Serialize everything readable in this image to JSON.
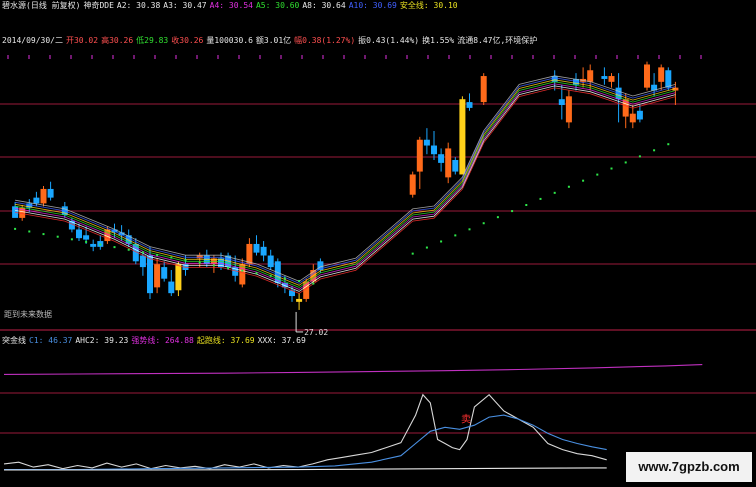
{
  "header": {
    "line1": [
      {
        "text": "碧水源(日线 前复权)",
        "color": "#e8e8e8"
      },
      {
        "text": "神奇DDE",
        "color": "#e8e8e8"
      },
      {
        "text": "A2: 30.38",
        "color": "#e8e8e8"
      },
      {
        "text": "A3: 30.47",
        "color": "#e8e8e8"
      },
      {
        "text": "A4: 30.54",
        "color": "#e030e0"
      },
      {
        "text": "A5: 30.60",
        "color": "#30e030"
      },
      {
        "text": "A8: 30.64",
        "color": "#e8e8e8"
      },
      {
        "text": "A10: 30.69",
        "color": "#4060ff"
      },
      {
        "text": "安全线: 30.10",
        "color": "#e8e020"
      }
    ],
    "line2": [
      {
        "text": "2014/09/30/二",
        "color": "#e8e8e8"
      },
      {
        "text": "开30.02",
        "color": "#ff5050"
      },
      {
        "text": "高30.26",
        "color": "#ff5050"
      },
      {
        "text": "低29.83",
        "color": "#30e030"
      },
      {
        "text": "收30.26",
        "color": "#ff5050"
      },
      {
        "text": "量100030.6",
        "color": "#e8e8e8"
      },
      {
        "text": "额3.01亿",
        "color": "#e8e8e8"
      },
      {
        "text": "幅0.38(1.27%)",
        "color": "#ff5050"
      },
      {
        "text": "振0.43(1.44%)",
        "color": "#e8e8e8"
      },
      {
        "text": "换1.55%",
        "color": "#e8e8e8"
      },
      {
        "text": "流通8.47亿,环境保护",
        "color": "#e8e8e8"
      }
    ]
  },
  "annotations": {
    "low_label": "27.02",
    "note": "距到未来数据"
  },
  "indicator": {
    "labels": [
      {
        "text": "突金线",
        "color": "#e8e8e8"
      },
      {
        "text": "C1: 46.37",
        "color": "#4a90e2"
      },
      {
        "text": "AHC2: 39.23",
        "color": "#e8e8e8"
      },
      {
        "text": "强势线: 264.88",
        "color": "#e030e0"
      },
      {
        "text": "起跑线: 37.69",
        "color": "#e8e020"
      },
      {
        "text": "XXX: 37.69",
        "color": "#e8e8e8"
      }
    ],
    "sell_label": "卖",
    "sell_color": "#ff3030"
  },
  "watermark": "www.7gpzb.com",
  "colors": {
    "up": "#ff6a1a",
    "down": "#1aa7ff",
    "yellow": "#ffd11a",
    "dots": "#2ee84a",
    "grid": "#9a1a3a",
    "strong": "#c030c0",
    "line_white": "#d8d8d8",
    "line_blue": "#4a90e2"
  },
  "chart_data": [
    {
      "type": "candlestick",
      "ylim": [
        26.5,
        36
      ],
      "x_count": 84,
      "candles": [
        [
          1,
          30.6,
          30.75,
          30.45,
          30.2,
          "down"
        ],
        [
          2,
          30.2,
          30.65,
          30.1,
          30.55,
          "up"
        ],
        [
          3,
          30.55,
          30.85,
          30.4,
          30.7,
          "down"
        ],
        [
          4,
          30.9,
          31.1,
          30.6,
          30.7,
          "down"
        ],
        [
          5,
          30.7,
          31.3,
          30.6,
          31.2,
          "up"
        ],
        [
          6,
          31.2,
          31.45,
          30.8,
          30.9,
          "down"
        ],
        [
          8,
          30.6,
          30.75,
          30.2,
          30.3,
          "down"
        ],
        [
          9,
          30.1,
          30.2,
          29.7,
          29.8,
          "down"
        ],
        [
          10,
          29.8,
          30.0,
          29.4,
          29.5,
          "down"
        ],
        [
          11,
          29.6,
          29.9,
          29.3,
          29.45,
          "down"
        ],
        [
          12,
          29.3,
          29.45,
          29.05,
          29.2,
          "down"
        ],
        [
          13,
          29.2,
          29.6,
          29.1,
          29.4,
          "down"
        ],
        [
          14,
          29.4,
          29.9,
          29.3,
          29.8,
          "up"
        ],
        [
          15,
          29.8,
          30.0,
          29.5,
          29.7,
          "down"
        ],
        [
          16,
          29.7,
          29.95,
          29.4,
          29.6,
          "down"
        ],
        [
          17,
          29.6,
          29.8,
          29.2,
          29.3,
          "down"
        ],
        [
          18,
          29.3,
          29.5,
          28.6,
          28.7,
          "down"
        ],
        [
          19,
          28.5,
          29.0,
          28.2,
          28.9,
          "down"
        ],
        [
          20,
          28.9,
          29.2,
          27.4,
          27.6,
          "down"
        ],
        [
          21,
          27.8,
          28.8,
          27.6,
          28.6,
          "up"
        ],
        [
          22,
          28.5,
          28.7,
          28.0,
          28.1,
          "down"
        ],
        [
          23,
          28.0,
          28.4,
          27.5,
          27.6,
          "down"
        ],
        [
          24,
          27.7,
          28.7,
          27.5,
          28.6,
          "yellow"
        ],
        [
          25,
          28.6,
          28.9,
          28.2,
          28.4,
          "down"
        ],
        [
          27,
          28.8,
          29.0,
          28.5,
          28.9,
          "up"
        ],
        [
          28,
          28.9,
          29.1,
          28.5,
          28.6,
          "down"
        ],
        [
          29,
          28.6,
          28.9,
          28.3,
          28.8,
          "up"
        ],
        [
          30,
          28.8,
          29.0,
          28.4,
          28.5,
          "down"
        ],
        [
          31,
          28.9,
          29.0,
          28.4,
          28.5,
          "down"
        ],
        [
          32,
          28.5,
          28.9,
          28.0,
          28.2,
          "down"
        ],
        [
          33,
          27.9,
          28.8,
          27.8,
          28.6,
          "up"
        ],
        [
          34,
          28.6,
          29.5,
          28.5,
          29.3,
          "up"
        ],
        [
          35,
          29.3,
          29.6,
          28.9,
          29.0,
          "down"
        ],
        [
          36,
          29.2,
          29.4,
          28.7,
          28.9,
          "down"
        ],
        [
          37,
          28.9,
          29.1,
          28.4,
          28.5,
          "down"
        ],
        [
          38,
          28.7,
          28.8,
          27.8,
          27.95,
          "down"
        ],
        [
          39,
          27.95,
          28.2,
          27.6,
          27.8,
          "down"
        ],
        [
          40,
          27.7,
          27.85,
          27.3,
          27.5,
          "down"
        ],
        [
          41,
          27.3,
          27.6,
          27.02,
          27.4,
          "yellow"
        ],
        [
          42,
          27.4,
          28.1,
          27.3,
          28.0,
          "up"
        ],
        [
          43,
          28.0,
          28.6,
          27.9,
          28.4,
          "up"
        ],
        [
          44,
          28.4,
          28.8,
          28.3,
          28.7,
          "down"
        ],
        [
          57,
          31.0,
          31.8,
          30.9,
          31.7,
          "up"
        ],
        [
          58,
          31.8,
          33.0,
          31.2,
          32.9,
          "up"
        ],
        [
          59,
          32.9,
          33.3,
          32.4,
          32.7,
          "down"
        ],
        [
          60,
          32.7,
          33.2,
          32.2,
          32.4,
          "down"
        ],
        [
          61,
          32.4,
          32.6,
          31.8,
          32.1,
          "down"
        ],
        [
          62,
          31.6,
          32.8,
          31.4,
          32.6,
          "up"
        ],
        [
          63,
          31.8,
          32.3,
          31.7,
          32.2,
          "down"
        ],
        [
          64,
          31.7,
          34.4,
          31.7,
          34.3,
          "yellow"
        ],
        [
          65,
          34.2,
          34.5,
          33.9,
          34.0,
          "down"
        ],
        [
          67,
          34.2,
          35.2,
          34.1,
          35.1,
          "up"
        ],
        [
          77,
          34.9,
          35.3,
          34.6,
          35.1,
          "down"
        ],
        [
          78,
          34.3,
          34.8,
          33.6,
          34.1,
          "down"
        ],
        [
          79,
          33.5,
          34.6,
          33.3,
          34.4,
          "up"
        ],
        [
          80,
          34.8,
          35.2,
          34.6,
          35.0,
          "down"
        ],
        [
          81,
          35.0,
          35.4,
          34.7,
          34.9,
          "up"
        ],
        [
          82,
          34.9,
          35.5,
          34.6,
          35.3,
          "up"
        ],
        [
          84,
          35.1,
          35.4,
          34.8,
          35.0,
          "down"
        ],
        [
          85,
          34.9,
          35.2,
          34.7,
          35.1,
          "up"
        ],
        [
          86,
          34.3,
          35.2,
          33.5,
          34.7,
          "down"
        ],
        [
          87,
          34.3,
          34.5,
          33.3,
          33.7,
          "up"
        ],
        [
          88,
          33.8,
          34.1,
          33.3,
          33.5,
          "up"
        ],
        [
          89,
          33.6,
          34.1,
          33.5,
          33.9,
          "down"
        ],
        [
          90,
          34.7,
          35.6,
          34.6,
          35.5,
          "up"
        ],
        [
          91,
          34.6,
          35.2,
          34.4,
          34.8,
          "down"
        ],
        [
          92,
          34.9,
          35.5,
          34.6,
          35.4,
          "up"
        ],
        [
          93,
          35.3,
          35.4,
          34.6,
          34.7,
          "down"
        ],
        [
          94,
          34.7,
          34.9,
          34.1,
          34.6,
          "up"
        ]
      ]
    },
    {
      "type": "line",
      "ylim": [
        0,
        300
      ],
      "series": [
        {
          "name": "强势线",
          "color": "#c030c0",
          "points": [
            [
              0,
              240
            ],
            [
              10,
              241
            ],
            [
              20,
              242
            ],
            [
              30,
              243
            ],
            [
              40,
              245
            ],
            [
              50,
              247
            ],
            [
              60,
              249
            ],
            [
              70,
              252
            ],
            [
              80,
              256
            ],
            [
              90,
              261
            ],
            [
              95,
              264
            ]
          ]
        },
        {
          "name": "AHC2",
          "color": "#d8d8d8",
          "points": [
            [
              0,
              20
            ],
            [
              2,
              24
            ],
            [
              4,
              12
            ],
            [
              6,
              18
            ],
            [
              8,
              8
            ],
            [
              10,
              16
            ],
            [
              12,
              10
            ],
            [
              14,
              22
            ],
            [
              16,
              12
            ],
            [
              18,
              20
            ],
            [
              20,
              8
            ],
            [
              22,
              16
            ],
            [
              24,
              10
            ],
            [
              26,
              14
            ],
            [
              28,
              8
            ],
            [
              30,
              18
            ],
            [
              32,
              12
            ],
            [
              34,
              20
            ],
            [
              36,
              10
            ],
            [
              38,
              16
            ],
            [
              40,
              12
            ],
            [
              42,
              20
            ],
            [
              44,
              30
            ],
            [
              46,
              36
            ],
            [
              48,
              42
            ],
            [
              50,
              48
            ],
            [
              52,
              60
            ],
            [
              54,
              72
            ],
            [
              56,
              140
            ],
            [
              57,
              190
            ],
            [
              58,
              170
            ],
            [
              59,
              80
            ],
            [
              60,
              70
            ],
            [
              61,
              60
            ],
            [
              62,
              55
            ],
            [
              63,
              80
            ],
            [
              64,
              160
            ],
            [
              66,
              190
            ],
            [
              68,
              150
            ],
            [
              70,
              130
            ],
            [
              72,
              110
            ],
            [
              74,
              70
            ],
            [
              76,
              55
            ],
            [
              78,
              45
            ],
            [
              80,
              40
            ],
            [
              82,
              30
            ]
          ]
        },
        {
          "name": "C1",
          "color": "#4a90e2",
          "points": [
            [
              0,
              6
            ],
            [
              10,
              6
            ],
            [
              20,
              8
            ],
            [
              30,
              10
            ],
            [
              40,
              12
            ],
            [
              45,
              15
            ],
            [
              50,
              24
            ],
            [
              54,
              40
            ],
            [
              56,
              70
            ],
            [
              58,
              100
            ],
            [
              60,
              110
            ],
            [
              62,
              105
            ],
            [
              64,
              115
            ],
            [
              66,
              135
            ],
            [
              68,
              140
            ],
            [
              70,
              130
            ],
            [
              72,
              115
            ],
            [
              74,
              95
            ],
            [
              76,
              80
            ],
            [
              78,
              70
            ],
            [
              80,
              62
            ],
            [
              82,
              55
            ]
          ]
        },
        {
          "name": "XXX",
          "color": "#e8e8e8",
          "points": [
            [
              0,
              5
            ],
            [
              20,
              5
            ],
            [
              40,
              6
            ],
            [
              60,
              8
            ],
            [
              80,
              10
            ],
            [
              82,
              10
            ]
          ]
        }
      ]
    }
  ]
}
